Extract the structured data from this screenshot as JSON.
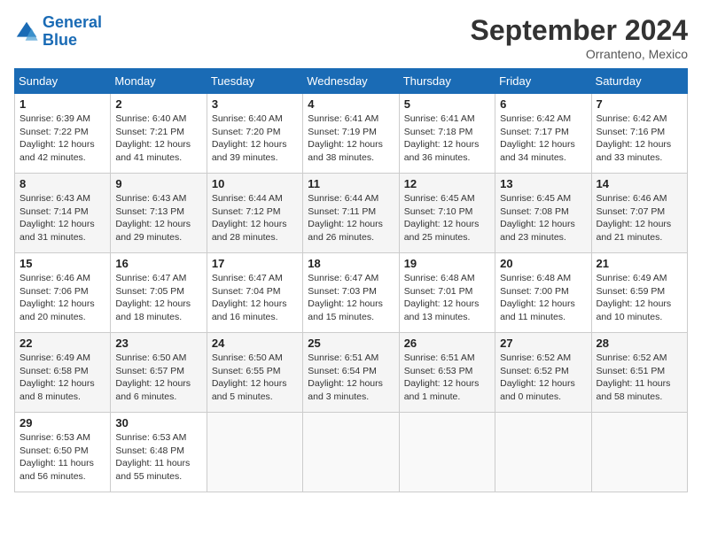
{
  "header": {
    "logo_line1": "General",
    "logo_line2": "Blue",
    "month_title": "September 2024",
    "subtitle": "Orranteno, Mexico"
  },
  "weekdays": [
    "Sunday",
    "Monday",
    "Tuesday",
    "Wednesday",
    "Thursday",
    "Friday",
    "Saturday"
  ],
  "weeks": [
    [
      {
        "day": "1",
        "sunrise": "6:39 AM",
        "sunset": "7:22 PM",
        "daylight": "12 hours and 42 minutes."
      },
      {
        "day": "2",
        "sunrise": "6:40 AM",
        "sunset": "7:21 PM",
        "daylight": "12 hours and 41 minutes."
      },
      {
        "day": "3",
        "sunrise": "6:40 AM",
        "sunset": "7:20 PM",
        "daylight": "12 hours and 39 minutes."
      },
      {
        "day": "4",
        "sunrise": "6:41 AM",
        "sunset": "7:19 PM",
        "daylight": "12 hours and 38 minutes."
      },
      {
        "day": "5",
        "sunrise": "6:41 AM",
        "sunset": "7:18 PM",
        "daylight": "12 hours and 36 minutes."
      },
      {
        "day": "6",
        "sunrise": "6:42 AM",
        "sunset": "7:17 PM",
        "daylight": "12 hours and 34 minutes."
      },
      {
        "day": "7",
        "sunrise": "6:42 AM",
        "sunset": "7:16 PM",
        "daylight": "12 hours and 33 minutes."
      }
    ],
    [
      {
        "day": "8",
        "sunrise": "6:43 AM",
        "sunset": "7:14 PM",
        "daylight": "12 hours and 31 minutes."
      },
      {
        "day": "9",
        "sunrise": "6:43 AM",
        "sunset": "7:13 PM",
        "daylight": "12 hours and 29 minutes."
      },
      {
        "day": "10",
        "sunrise": "6:44 AM",
        "sunset": "7:12 PM",
        "daylight": "12 hours and 28 minutes."
      },
      {
        "day": "11",
        "sunrise": "6:44 AM",
        "sunset": "7:11 PM",
        "daylight": "12 hours and 26 minutes."
      },
      {
        "day": "12",
        "sunrise": "6:45 AM",
        "sunset": "7:10 PM",
        "daylight": "12 hours and 25 minutes."
      },
      {
        "day": "13",
        "sunrise": "6:45 AM",
        "sunset": "7:08 PM",
        "daylight": "12 hours and 23 minutes."
      },
      {
        "day": "14",
        "sunrise": "6:46 AM",
        "sunset": "7:07 PM",
        "daylight": "12 hours and 21 minutes."
      }
    ],
    [
      {
        "day": "15",
        "sunrise": "6:46 AM",
        "sunset": "7:06 PM",
        "daylight": "12 hours and 20 minutes."
      },
      {
        "day": "16",
        "sunrise": "6:47 AM",
        "sunset": "7:05 PM",
        "daylight": "12 hours and 18 minutes."
      },
      {
        "day": "17",
        "sunrise": "6:47 AM",
        "sunset": "7:04 PM",
        "daylight": "12 hours and 16 minutes."
      },
      {
        "day": "18",
        "sunrise": "6:47 AM",
        "sunset": "7:03 PM",
        "daylight": "12 hours and 15 minutes."
      },
      {
        "day": "19",
        "sunrise": "6:48 AM",
        "sunset": "7:01 PM",
        "daylight": "12 hours and 13 minutes."
      },
      {
        "day": "20",
        "sunrise": "6:48 AM",
        "sunset": "7:00 PM",
        "daylight": "12 hours and 11 minutes."
      },
      {
        "day": "21",
        "sunrise": "6:49 AM",
        "sunset": "6:59 PM",
        "daylight": "12 hours and 10 minutes."
      }
    ],
    [
      {
        "day": "22",
        "sunrise": "6:49 AM",
        "sunset": "6:58 PM",
        "daylight": "12 hours and 8 minutes."
      },
      {
        "day": "23",
        "sunrise": "6:50 AM",
        "sunset": "6:57 PM",
        "daylight": "12 hours and 6 minutes."
      },
      {
        "day": "24",
        "sunrise": "6:50 AM",
        "sunset": "6:55 PM",
        "daylight": "12 hours and 5 minutes."
      },
      {
        "day": "25",
        "sunrise": "6:51 AM",
        "sunset": "6:54 PM",
        "daylight": "12 hours and 3 minutes."
      },
      {
        "day": "26",
        "sunrise": "6:51 AM",
        "sunset": "6:53 PM",
        "daylight": "12 hours and 1 minute."
      },
      {
        "day": "27",
        "sunrise": "6:52 AM",
        "sunset": "6:52 PM",
        "daylight": "12 hours and 0 minutes."
      },
      {
        "day": "28",
        "sunrise": "6:52 AM",
        "sunset": "6:51 PM",
        "daylight": "11 hours and 58 minutes."
      }
    ],
    [
      {
        "day": "29",
        "sunrise": "6:53 AM",
        "sunset": "6:50 PM",
        "daylight": "11 hours and 56 minutes."
      },
      {
        "day": "30",
        "sunrise": "6:53 AM",
        "sunset": "6:48 PM",
        "daylight": "11 hours and 55 minutes."
      },
      null,
      null,
      null,
      null,
      null
    ]
  ],
  "labels": {
    "sunrise": "Sunrise:",
    "sunset": "Sunset:",
    "daylight": "Daylight:"
  }
}
